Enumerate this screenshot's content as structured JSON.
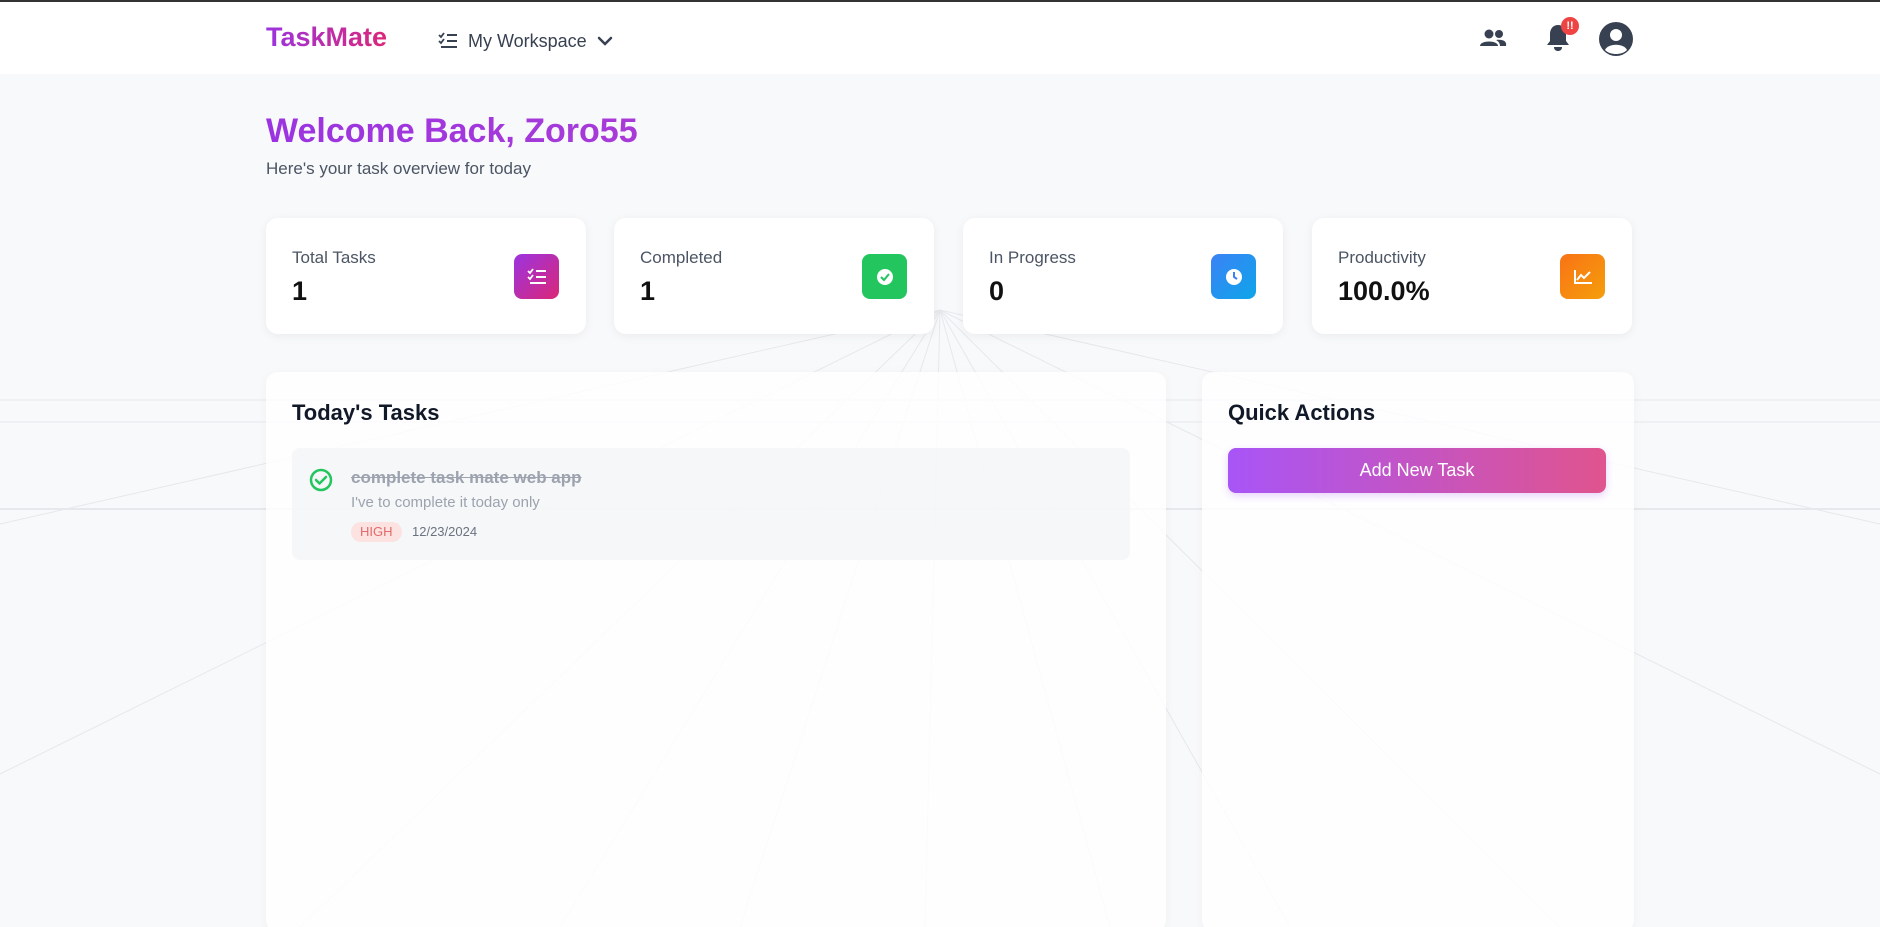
{
  "app": {
    "brand": "TaskMate"
  },
  "nav": {
    "workspace_label": "My Workspace",
    "notification_badge": "!!",
    "icons": [
      "list-check-icon",
      "chevron-down-icon",
      "users-icon",
      "bell-icon",
      "user-circle-icon"
    ]
  },
  "header": {
    "welcome": "Welcome Back, Zoro55",
    "subtitle": "Here's your task overview for today"
  },
  "stats": [
    {
      "label": "Total Tasks",
      "value": "1",
      "icon": "list-check-icon",
      "color": "#9b34e0"
    },
    {
      "label": "Completed",
      "value": "1",
      "icon": "check-circle-icon",
      "color": "#22c55e"
    },
    {
      "label": "In Progress",
      "value": "0",
      "icon": "clock-icon",
      "color": "#3b82f6"
    },
    {
      "label": "Productivity",
      "value": "100.0%",
      "icon": "chart-line-icon",
      "color": "#f97316"
    }
  ],
  "today": {
    "title": "Today's Tasks",
    "tasks": [
      {
        "title": "complete task mate web app",
        "description": "I've to complete it today only",
        "priority": "HIGH",
        "date": "12/23/2024",
        "completed": true
      }
    ]
  },
  "quick_actions": {
    "title": "Quick Actions",
    "add_button": "Add New Task"
  },
  "colors": {
    "brand_gradient_start": "#9b34e0",
    "brand_gradient_end": "#db2777",
    "priority_high_bg": "#fde2e2",
    "priority_high_text": "#e26b6b"
  }
}
